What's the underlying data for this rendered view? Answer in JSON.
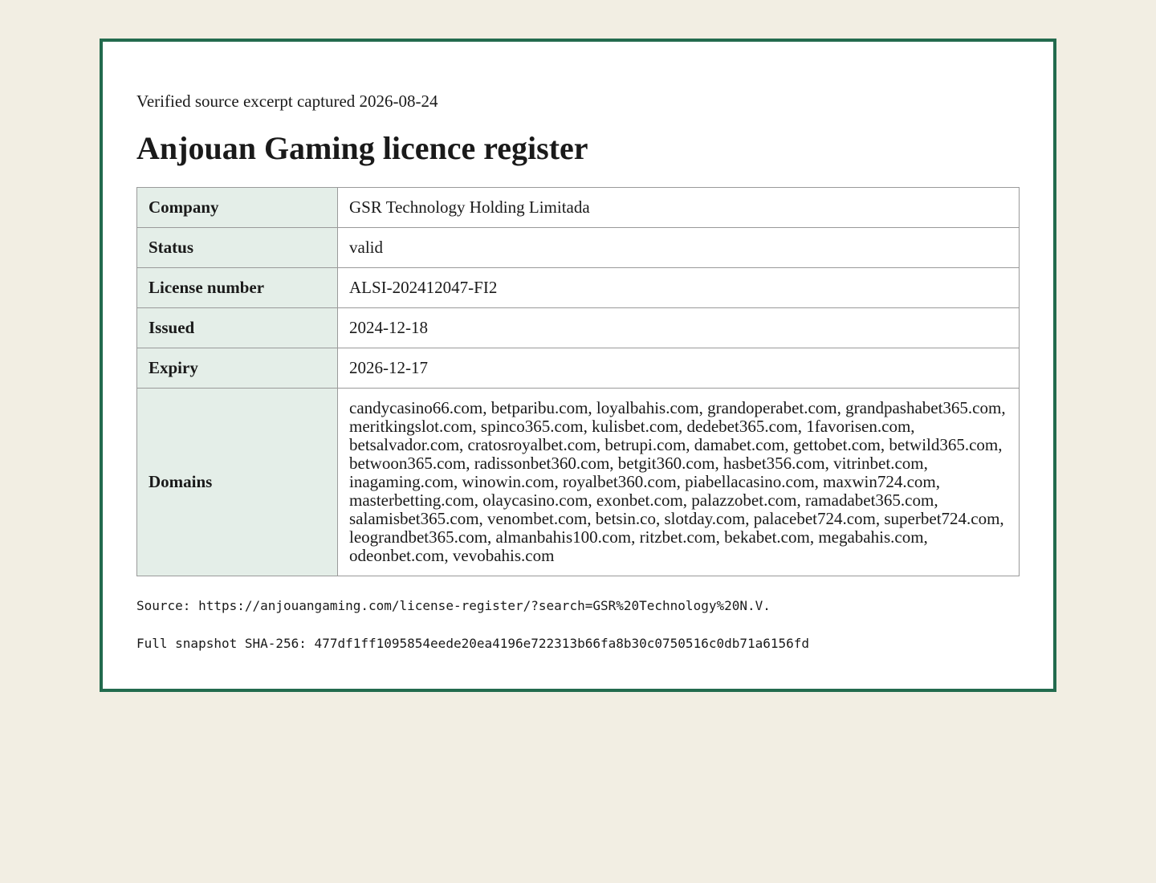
{
  "capture_note": "Verified source excerpt captured 2026-08-24",
  "title": "Anjouan Gaming licence register",
  "rows": [
    {
      "label": "Company",
      "value": "GSR Technology Holding Limitada"
    },
    {
      "label": "Status",
      "value": "valid"
    },
    {
      "label": "License number",
      "value": "ALSI-202412047-FI2"
    },
    {
      "label": "Issued",
      "value": "2024-12-18"
    },
    {
      "label": "Expiry",
      "value": "2026-12-17"
    },
    {
      "label": "Domains",
      "value": "candycasino66.com, betparibu.com, loyalbahis.com, grandoperabet.com, grandpashabet365.com, meritkingslot.com, spinco365.com, kulisbet.com, dedebet365.com, 1favorisen.com, betsalvador.com, cratosroyalbet.com, betrupi.com, damabet.com, gettobet.com, betwild365.com, betwoon365.com, radissonbet360.com, betgit360.com, hasbet356.com, vitrinbet.com, inagaming.com, winowin.com, royalbet360.com, piabellacasino.com, maxwin724.com, masterbetting.com, olaycasino.com, exonbet.com, palazzobet.com, ramadabet365.com, salamisbet365.com, venombet.com, betsin.co, slotday.com, palacebet724.com, superbet724.com, leograndbet365.com, almanbahis100.com, ritzbet.com, bekabet.com, megabahis.com, odeonbet.com, vevobahis.com"
    }
  ],
  "source_line": "Source: https://anjouangaming.com/license-register/?search=GSR%20Technology%20N.V.",
  "hash_line": "Full snapshot SHA-256: 477df1ff1095854eede20ea4196e722313b66fa8b30c0750516c0db71a6156fd",
  "colors": {
    "page_background": "#f2eee3",
    "frame_border": "#236b4e",
    "label_cell_background": "#e4eee8"
  }
}
